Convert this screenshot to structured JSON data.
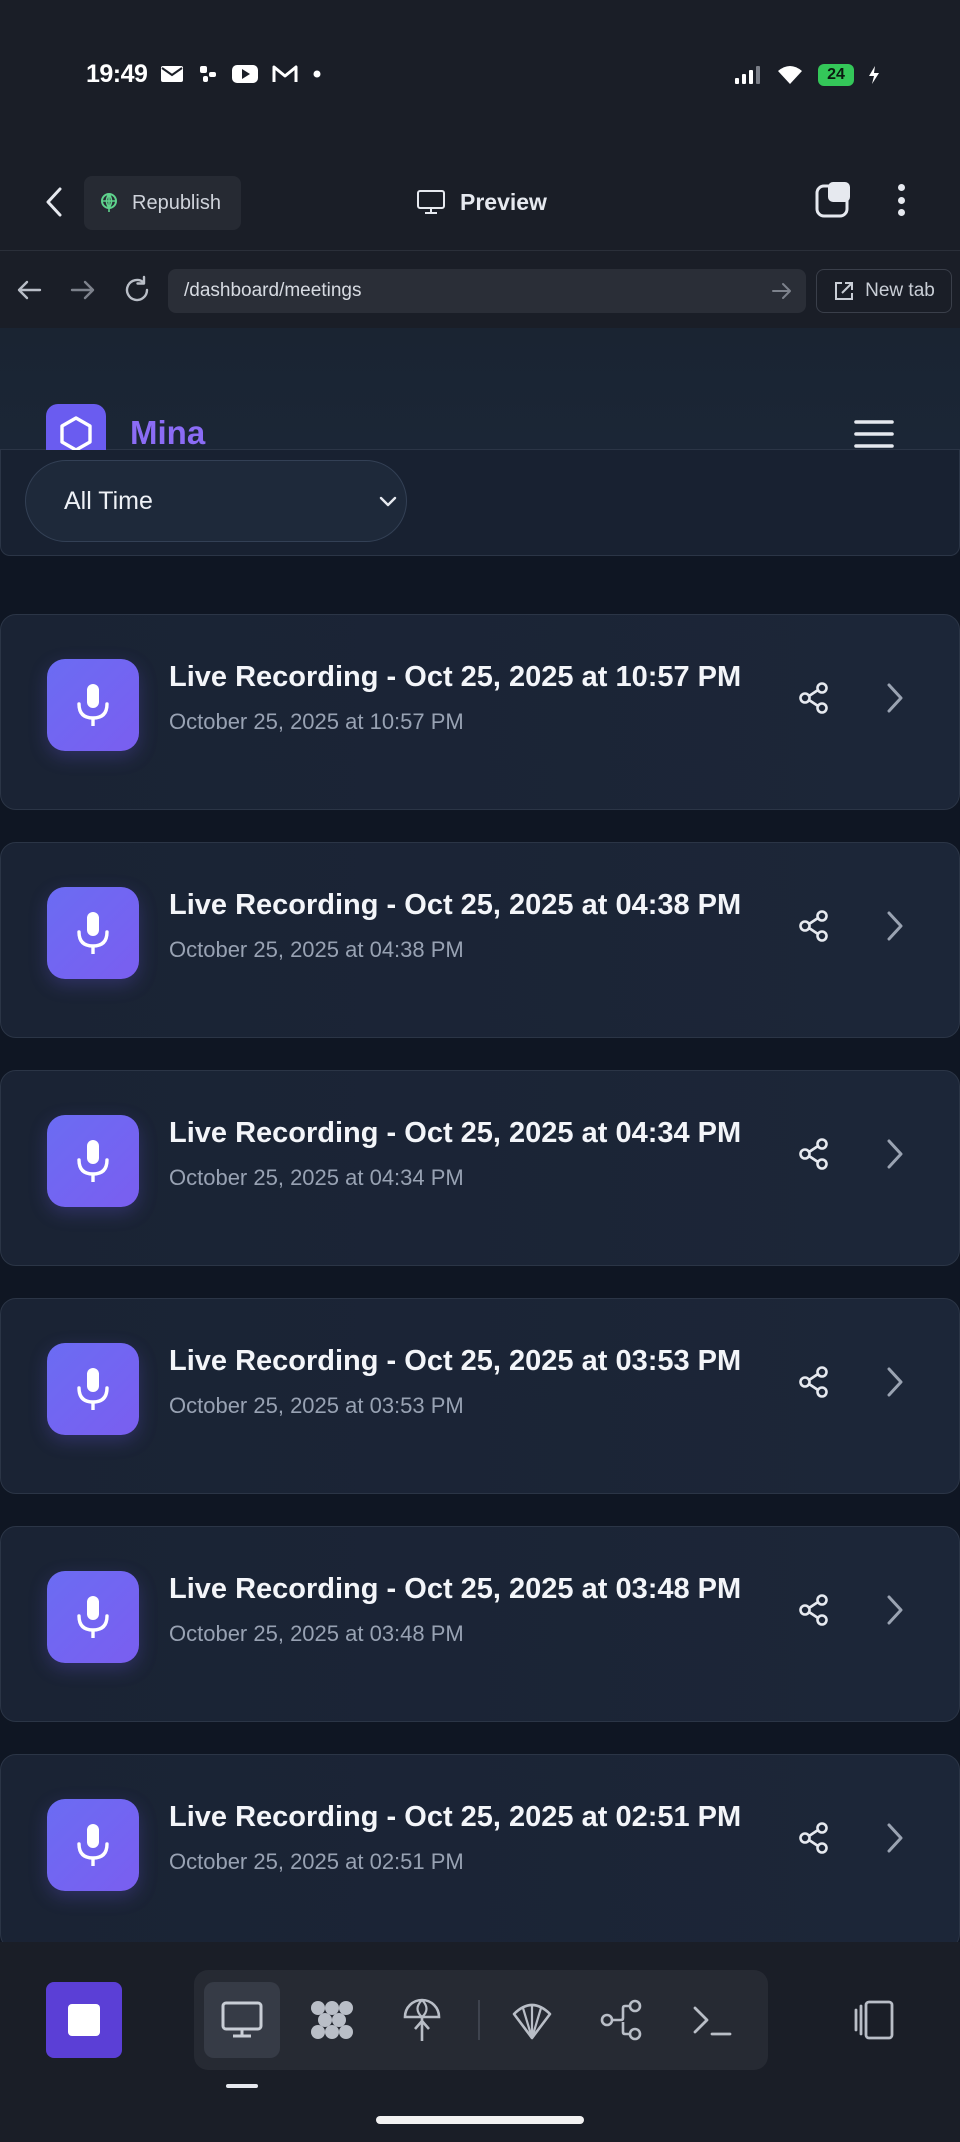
{
  "status_bar": {
    "time": "19:49",
    "battery": "24",
    "left_icons": [
      "mail-icon",
      "slack-icon",
      "youtube-icon",
      "gmail-icon",
      "dot-icon"
    ],
    "right_icons": [
      "signal-icon",
      "wifi-icon",
      "battery-icon"
    ]
  },
  "app_bar": {
    "republish_label": "Republish",
    "preview_label": "Preview"
  },
  "browser": {
    "url": "/dashboard/meetings",
    "new_tab_label": "New tab"
  },
  "site": {
    "brand": "Mina",
    "filter_value": "All Time"
  },
  "recordings": [
    {
      "title": "Live Recording - Oct 25, 2025 at 10:57 PM",
      "date": "October 25, 2025 at 10:57 PM"
    },
    {
      "title": "Live Recording - Oct 25, 2025 at 04:38 PM",
      "date": "October 25, 2025 at 04:38 PM"
    },
    {
      "title": "Live Recording - Oct 25, 2025 at 04:34 PM",
      "date": "October 25, 2025 at 04:34 PM"
    },
    {
      "title": "Live Recording - Oct 25, 2025 at 03:53 PM",
      "date": "October 25, 2025 at 03:53 PM"
    },
    {
      "title": "Live Recording - Oct 25, 2025 at 03:48 PM",
      "date": "October 25, 2025 at 03:48 PM"
    },
    {
      "title": "Live Recording - Oct 25, 2025 at 02:51 PM",
      "date": "October 25, 2025 at 02:51 PM"
    }
  ],
  "dock": {
    "tools": [
      "preview-icon",
      "nodes-icon",
      "deploy-icon",
      "shell-icon",
      "git-icon",
      "terminal-icon"
    ],
    "active_tool": "preview-icon"
  },
  "colors": {
    "accent": "#6a5cf0",
    "brand_text": "#8b6cf5",
    "background": "#0f1623",
    "card": "#1a2334"
  }
}
